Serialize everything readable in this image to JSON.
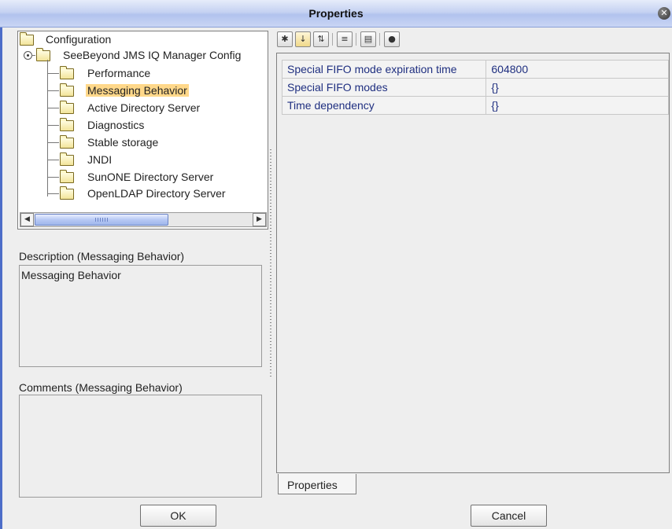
{
  "window": {
    "title": "Properties"
  },
  "tree": {
    "root": "Configuration",
    "child": "SeeBeyond JMS IQ Manager Config",
    "items": [
      {
        "label": "Performance",
        "selected": false
      },
      {
        "label": "Messaging Behavior",
        "selected": true
      },
      {
        "label": "Active Directory Server",
        "selected": false
      },
      {
        "label": "Diagnostics",
        "selected": false
      },
      {
        "label": "Stable storage",
        "selected": false
      },
      {
        "label": "JNDI",
        "selected": false
      },
      {
        "label": "SunONE Directory Server",
        "selected": false
      },
      {
        "label": "OpenLDAP Directory Server",
        "selected": false
      }
    ]
  },
  "description": {
    "label": "Description (Messaging Behavior)",
    "text": "Messaging Behavior"
  },
  "comments": {
    "label": "Comments (Messaging Behavior)",
    "text": ""
  },
  "toolbar": {
    "icons": [
      "categorized-icon",
      "sort-alpha-icon",
      "sort-category-icon",
      "edit-list-icon",
      "view-icon",
      "help-icon"
    ]
  },
  "properties": [
    {
      "name": "Special FIFO mode expiration time",
      "value": "604800"
    },
    {
      "name": "Special FIFO modes",
      "value": "{}"
    },
    {
      "name": "Time dependency",
      "value": "{}"
    }
  ],
  "tab": {
    "label": "Properties"
  },
  "buttons": {
    "ok": "OK",
    "cancel": "Cancel"
  },
  "colors": {
    "selection": "#ffd88a",
    "titlebar": "#b2c3ee",
    "property_text": "#1f2f80"
  }
}
